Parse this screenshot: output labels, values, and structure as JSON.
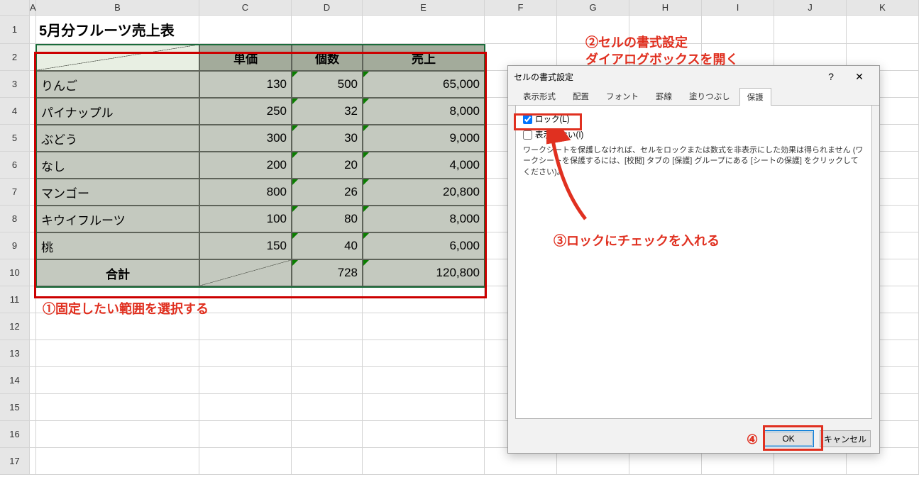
{
  "columns": [
    "A",
    "B",
    "C",
    "D",
    "E",
    "F",
    "G",
    "H",
    "I",
    "J",
    "K"
  ],
  "row_numbers": [
    1,
    2,
    3,
    4,
    5,
    6,
    7,
    8,
    9,
    10,
    11,
    12,
    13,
    14,
    15,
    16,
    17
  ],
  "title": "5月分フルーツ売上表",
  "table": {
    "headers": {
      "c": "単価",
      "d": "個数",
      "e": "売上"
    },
    "rows": [
      {
        "name": "りんご",
        "price": "130",
        "qty": "500",
        "sales": "65,000"
      },
      {
        "name": "パイナップル",
        "price": "250",
        "qty": "32",
        "sales": "8,000"
      },
      {
        "name": "ぶどう",
        "price": "300",
        "qty": "30",
        "sales": "9,000"
      },
      {
        "name": "なし",
        "price": "200",
        "qty": "20",
        "sales": "4,000"
      },
      {
        "name": "マンゴー",
        "price": "800",
        "qty": "26",
        "sales": "20,800"
      },
      {
        "name": "キウイフルーツ",
        "price": "100",
        "qty": "80",
        "sales": "8,000"
      },
      {
        "name": "桃",
        "price": "150",
        "qty": "40",
        "sales": "6,000"
      }
    ],
    "total": {
      "label": "合計",
      "qty": "728",
      "sales": "120,800"
    }
  },
  "dialog": {
    "title": "セルの書式設定",
    "tabs": [
      "表示形式",
      "配置",
      "フォント",
      "罫線",
      "塗りつぶし",
      "保護"
    ],
    "active_tab": "保護",
    "lock_label": "ロック(L)",
    "hide_label": "表示しない(I)",
    "note": "ワークシートを保護しなければ、セルをロックまたは数式を非表示にした効果は得られません (ワークシートを保護するには、[校閲] タブの [保護] グループにある [シートの保護] をクリックしてください)。",
    "ok": "OK",
    "cancel": "キャンセル",
    "help_icon": "?",
    "close_icon": "✕"
  },
  "annotations": {
    "a1": "①固定したい範囲を選択する",
    "a2a": "②セルの書式設定",
    "a2b": "ダイアログボックスを開く",
    "a3": "③ロックにチェックを入れる",
    "a4": "④"
  }
}
